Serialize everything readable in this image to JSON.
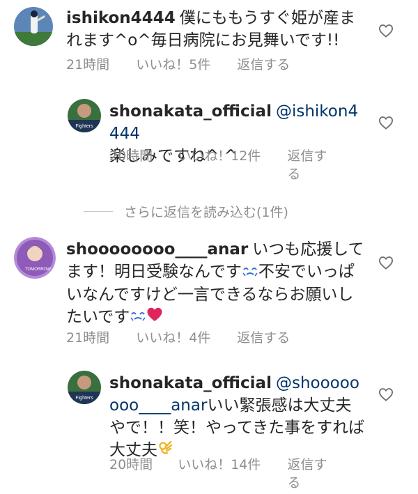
{
  "comments": [
    {
      "username": "ishikon4444",
      "text": "僕にももうすぐ姫が産まれます^o^毎日病院にお見舞いです!!",
      "time": "21時間",
      "likes": "いいね！5件",
      "reply": "返信する"
    },
    {
      "username": "shonakata_official",
      "mention": "@ishikon4444",
      "text": "楽しみですね^ ^",
      "time": "20時間",
      "likes": "いいね！12件",
      "reply_line1": "返信す",
      "reply_line2": "る"
    },
    {
      "username": "shoooooooo____anar",
      "text_a": "いつも応援してます！明日受験なんです",
      "text_b": "不安でいっぱいなんですけど一言できるならお願いしたいです",
      "time": "21時間",
      "likes": "いいね！4件",
      "reply": "返信する"
    },
    {
      "username": "shonakata_official",
      "mention": "@shoooooooo____anar",
      "text": "いい緊張感は大丈夫やで！！笑！やってきた事をすれば大丈夫",
      "time": "20時間",
      "likes": "いいね！14件",
      "reply_line1": "返信す",
      "reply_line2": "る"
    }
  ],
  "load_more": "さらに返信を読み込む(1件)",
  "icons": {
    "like": "heart-outline-icon",
    "anxious_emoji": "anxious-face-emoji",
    "red_heart_emoji": "red-heart-emoji",
    "ok_hand_emoji": "ok-hand-emoji"
  },
  "colors": {
    "text": "#262626",
    "meta": "#8e8e8e",
    "mention": "#003569",
    "heart": "#e0245e"
  }
}
